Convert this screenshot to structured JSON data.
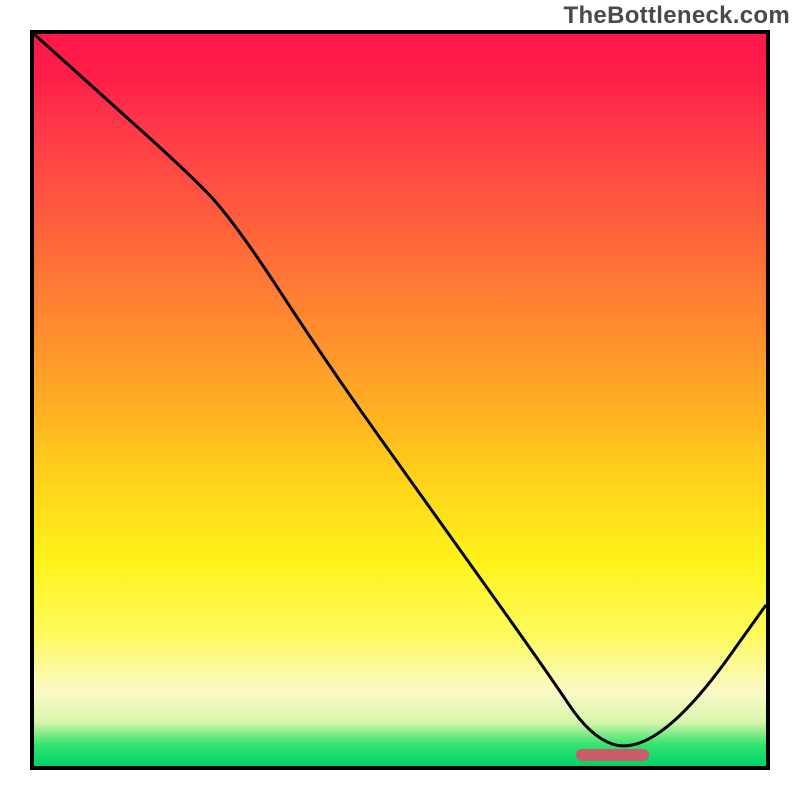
{
  "watermark": "TheBottleneck.com",
  "colors": {
    "border": "#000000",
    "curve": "#000000",
    "marker": "#cb5d6b",
    "gradient_top": "#ff1749",
    "gradient_mid": "#ffcf1a",
    "gradient_bottom": "#00d36a"
  },
  "chart_data": {
    "type": "line",
    "title": "",
    "xlabel": "",
    "ylabel": "",
    "xlim": [
      0,
      100
    ],
    "ylim": [
      0,
      100
    ],
    "x": [
      0,
      10,
      20,
      27,
      40,
      55,
      70,
      76,
      82,
      90,
      100
    ],
    "values": [
      100,
      91,
      82,
      75,
      55,
      34,
      13,
      4,
      2,
      8,
      22
    ],
    "optimum_band": {
      "x_start": 74,
      "x_end": 84,
      "y": 1.5
    },
    "note": "x and values are in percent of plot area; y=0 at bottom (green), y=100 at top (red)."
  }
}
